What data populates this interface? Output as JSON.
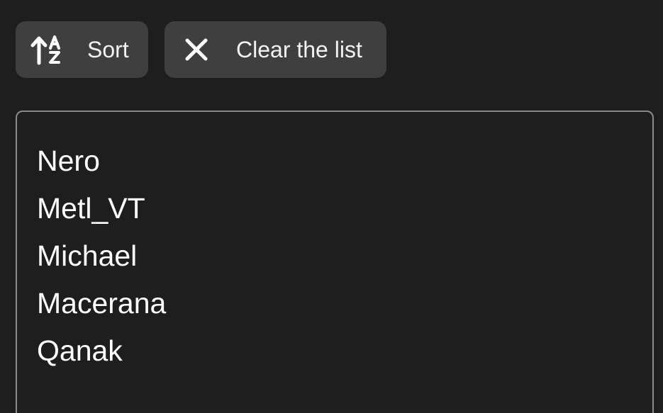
{
  "toolbar": {
    "sort": {
      "label": "Sort",
      "icon": "sort-alpha-ascending-icon"
    },
    "clear": {
      "label": "Clear the list",
      "icon": "close-icon"
    }
  },
  "list": {
    "items": [
      "Nero",
      "Metl_VT",
      "Michael",
      "Macerana",
      "Qanak"
    ]
  },
  "colors": {
    "background": "#1e1e1e",
    "button": "#3f3f3f",
    "border": "#8a8a8a",
    "text": "#ffffff"
  }
}
